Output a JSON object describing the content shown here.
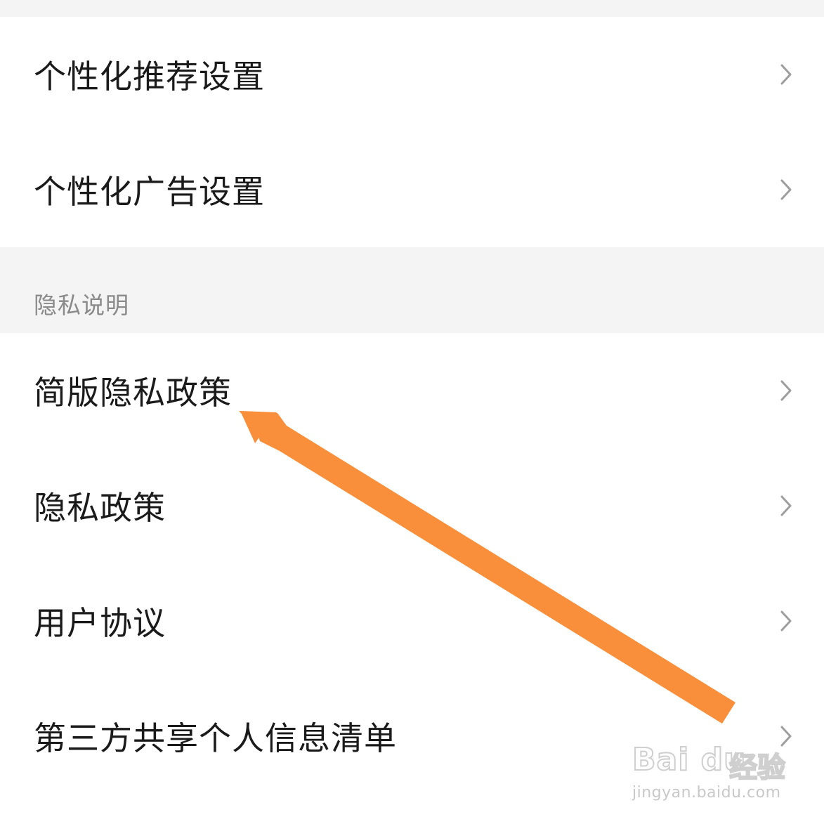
{
  "settings_top": {
    "items": [
      {
        "label": "个性化推荐设置"
      },
      {
        "label": "个性化广告设置"
      }
    ]
  },
  "privacy_section": {
    "header": "隐私说明",
    "items": [
      {
        "label": "简版隐私政策"
      },
      {
        "label": "隐私政策"
      },
      {
        "label": "用户协议"
      },
      {
        "label": "第三方共享个人信息清单"
      }
    ]
  },
  "icons": {
    "row_chevron": "chevron-right-icon",
    "annotation": "arrow-icon"
  },
  "colors": {
    "annotation_arrow": "#fa8f3b",
    "section_background": "#f4f4f4",
    "chevron": "#9e9e9e"
  },
  "watermark": {
    "brand": "Bai du",
    "product": "经验",
    "url": "jingyan.baidu.com"
  }
}
